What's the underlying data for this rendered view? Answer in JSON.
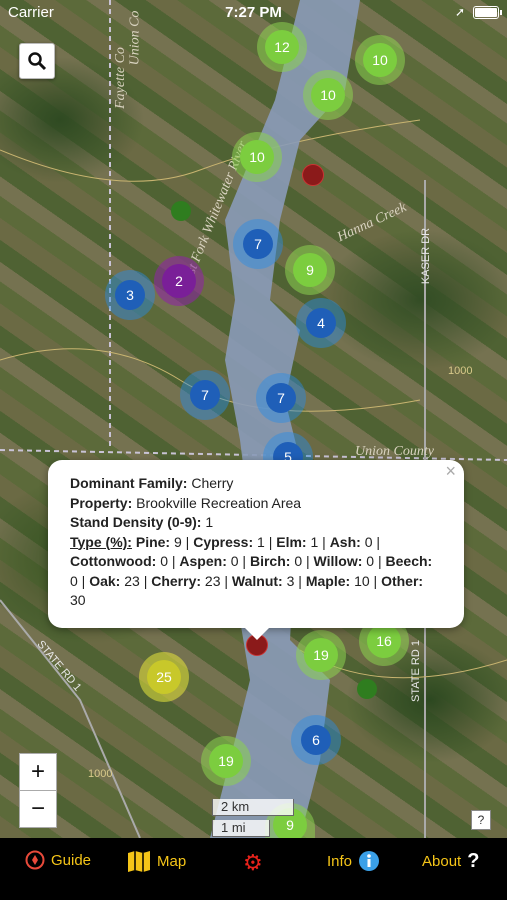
{
  "status_bar": {
    "carrier": "Carrier",
    "time": "7:27 PM"
  },
  "map": {
    "labels": {
      "river": "East Fork Whitewater River",
      "creek": "Hanna Creek",
      "county": "Union County",
      "fayette": "Fayette Co",
      "union": "Union Co",
      "kaser": "KASER DR",
      "state_rd_1": "STATE RD 1",
      "state_rd_right": "STATE RD 1",
      "road_1000": "1000",
      "road_1000b": "1000"
    },
    "clusters": [
      "12",
      "10",
      "10",
      "10",
      "7",
      "9",
      "2",
      "3",
      "4",
      "7",
      "7",
      "5",
      "16",
      "19",
      "25",
      "6",
      "19",
      "9"
    ],
    "colors": {
      "green": "#7ccd3f",
      "blue": "#1f5fb8",
      "purple": "#7a1f98",
      "yellow": "#c8c82a",
      "red_marker": "#8b1a1a",
      "water": "#8a9bb8"
    }
  },
  "popup": {
    "dominant_family_label": "Dominant Family:",
    "dominant_family": "Cherry",
    "property_label": "Property:",
    "property": "Brookville Recreation Area",
    "stand_density_label": "Stand Density (0-9):",
    "stand_density": "1",
    "type_label": "Type (%):",
    "pine_label": "Pine:",
    "pine": "9",
    "cypress_label": "Cypress:",
    "cypress": "1",
    "elm_label": "Elm:",
    "elm": "1",
    "ash_label": "Ash:",
    "ash": "0",
    "cottonwood_label": "Cottonwood:",
    "cottonwood": "0",
    "aspen_label": "Aspen:",
    "aspen": "0",
    "birch_label": "Birch:",
    "birch": "0",
    "willow_label": "Willow:",
    "willow": "0",
    "beech_label": "Beech:",
    "beech": "0",
    "oak_label": "Oak:",
    "oak": "23",
    "cherry_label": "Cherry:",
    "cherry": "23",
    "walnut_label": "Walnut:",
    "walnut": "3",
    "maple_label": "Maple:",
    "maple": "10",
    "other_label": "Other:",
    "other": "30",
    "close": "×"
  },
  "controls": {
    "zoom_in": "+",
    "zoom_out": "−",
    "scale_km": "2 km",
    "scale_mi": "1 mi",
    "help": "?"
  },
  "tabbar": {
    "guide": "Guide",
    "map": "Map",
    "info": "Info",
    "about": "About"
  }
}
